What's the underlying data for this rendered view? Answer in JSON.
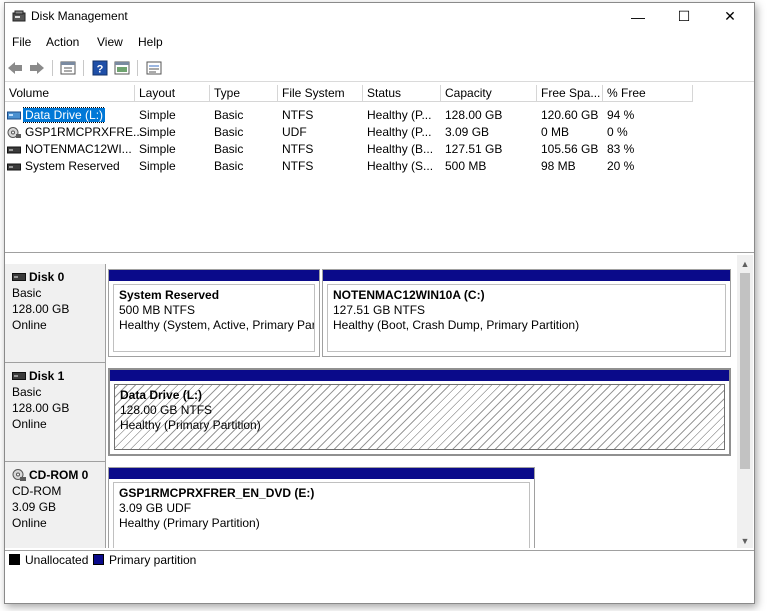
{
  "window": {
    "title": "Disk Management",
    "min": "—",
    "max": "☐",
    "close": "✕"
  },
  "menu": [
    "File",
    "Action",
    "View",
    "Help"
  ],
  "columns": [
    "Volume",
    "Layout",
    "Type",
    "File System",
    "Status",
    "Capacity",
    "Free Spa...",
    "% Free"
  ],
  "volumes": [
    {
      "name": "Data Drive (L:)",
      "layout": "Simple",
      "type": "Basic",
      "fs": "NTFS",
      "status": "Healthy (P...",
      "capacity": "128.00 GB",
      "free": "120.60 GB",
      "pct": "94 %",
      "icon": "drive-icon"
    },
    {
      "name": "GSP1RMCPRXFRE...",
      "layout": "Simple",
      "type": "Basic",
      "fs": "UDF",
      "status": "Healthy (P...",
      "capacity": "3.09 GB",
      "free": "0 MB",
      "pct": "0 %",
      "icon": "cd-icon"
    },
    {
      "name": "NOTENMAC12WI...",
      "layout": "Simple",
      "type": "Basic",
      "fs": "NTFS",
      "status": "Healthy (B...",
      "capacity": "127.51 GB",
      "free": "105.56 GB",
      "pct": "83 %",
      "icon": "drive-icon"
    },
    {
      "name": "System Reserved",
      "layout": "Simple",
      "type": "Basic",
      "fs": "NTFS",
      "status": "Healthy (S...",
      "capacity": "500 MB",
      "free": "98 MB",
      "pct": "20 %",
      "icon": "drive-icon"
    }
  ],
  "disks": [
    {
      "name": "Disk 0",
      "kind": "Basic",
      "size": "128.00 GB",
      "state": "Online",
      "partitions": [
        {
          "name": "System Reserved",
          "size": "500 MB NTFS",
          "status": "Healthy (System, Active, Primary Parti"
        },
        {
          "name": "NOTENMAC12WIN10A  (C:)",
          "size": "127.51 GB NTFS",
          "status": "Healthy (Boot, Crash Dump, Primary Partition)"
        }
      ]
    },
    {
      "name": "Disk 1",
      "kind": "Basic",
      "size": "128.00 GB",
      "state": "Online",
      "partitions": [
        {
          "name": "Data Drive  (L:)",
          "size": "128.00 GB NTFS",
          "status": "Healthy (Primary Partition)"
        }
      ]
    },
    {
      "name": "CD-ROM 0",
      "kind": "CD-ROM",
      "size": "3.09 GB",
      "state": "Online",
      "partitions": [
        {
          "name": "GSP1RMCPRXFRER_EN_DVD  (E:)",
          "size": "3.09 GB UDF",
          "status": "Healthy (Primary Partition)"
        }
      ]
    }
  ],
  "legend": [
    {
      "label": "Unallocated",
      "color": "#000000"
    },
    {
      "label": "Primary partition",
      "color": "#0a0a8a"
    }
  ],
  "colors": {
    "accent": "#0078d7",
    "partition_bar": "#0a0a8a"
  }
}
